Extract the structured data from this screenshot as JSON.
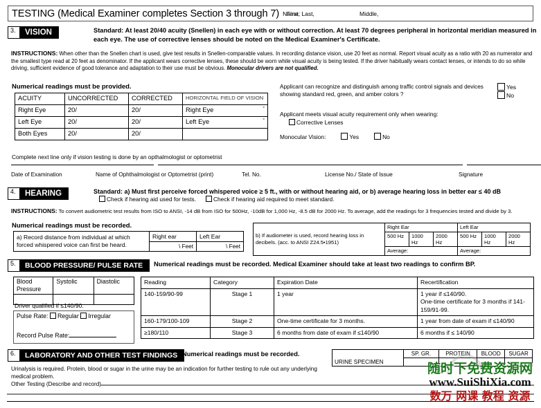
{
  "header": {
    "title": "TESTING (Medical Examiner completes Section 3 through 7)",
    "name_label": "Name:  Last,",
    "first_label": "First,",
    "middle_label": "Middle,"
  },
  "section3": {
    "number": "3.",
    "label": "VISION",
    "standard": "Standard: At least 20/40 acuity (Snellen) in each eye with or without correction. At least 70 degrees peripheral in horizontal meridian measured in each eye.  The use of corrective lenses should be noted on the Medical Examiner's Certificate.",
    "instructions_lead": "INSTRUCTIONS:",
    "instructions_body": " When other than the Snellen chart is used, give test results in Snellen-comparable values.  In recording distance vision, use 20 feet as normal.  Report visual acuity as a ratio with 20 as numerator and the smallest type read at 20 feet as denominator.  If the applicant wears corrective lenses, these should be worn while visual acuity is being tested.  If the driver habitually wears contact lenses, or intends to do so while driving, sufficient evidence of good tolerance and adaptation to their use must be obvious. ",
    "instructions_italic": "Monocular drivers are not qualified.",
    "numerical_note": "Numerical readings must be provided.",
    "acuity_table": {
      "headers": [
        "ACUITY",
        "UNCORRECTED",
        "CORRECTED",
        "HORIZONTAL FIELD OF VISION"
      ],
      "rows": [
        [
          "Right Eye",
          "20/",
          "20/",
          "Right Eye",
          "°"
        ],
        [
          "Left Eye",
          "20/",
          "20/",
          "Left Eye",
          "°"
        ],
        [
          "Both Eyes",
          "20/",
          "20/",
          "",
          ""
        ]
      ]
    },
    "complete_next_line": "Complete next line only if vision testing is done by an opthalmologist or optometrist",
    "question_traffic": "Applicant can recognize and distinguish among traffic control signals and devices showing standard red, green, and amber colors ?",
    "yes_label": "Yes",
    "no_label": "No",
    "question_acuity_wearing": "Applicant meets visual acuity requirement only when wearing:",
    "corrective_lenses_label": "Corrective Lenses",
    "monocular_label": "Monocular Vision:",
    "monocular_yes": "Yes",
    "monocular_no": "No",
    "signature_captions": [
      "Date of Examination",
      "Name of Ophthalmologist or Optometrist (print)",
      "Tel. No.",
      "License No./ State of Issue",
      "Signature"
    ]
  },
  "section4": {
    "number": "4.",
    "label": "HEARING",
    "standard": "Standard: a) Must first perceive forced whispered voice ≥ 5 ft., with or without hearing aid, or b) average hearing loss in better ear ≤ 40 dB",
    "check_used": "Check if hearing aid used for tests.",
    "check_required": "Check if hearing aid required to meet standard.",
    "instructions_lead": "INSTRUCTIONS:",
    "instructions_body": "  To convert audiometric test results from ISO to ANSI, -14 dB from ISO for 500Hz, -10dB for 1,000 Hz, -8.5 dB for 2000 Hz.  To average, add the readings for 3 frequencies tested and divide by 3.",
    "numerical_note": "Numerical readings must be recorded.",
    "item_a": "a) Record distance from individual at which forced whispered voice can first be heard.",
    "right_ear": "Right ear",
    "left_ear": "Left Ear",
    "feet": "\\ Feet",
    "item_b": "b) If audiometer is used, record hearing loss in decibels. (acc. to ANSI Z24.5•1951)",
    "audio_headers": {
      "right_ear": "Right Ear",
      "left_ear": "Left Ear",
      "freqs": [
        "500 Hz",
        "1000 Hz",
        "2000 Hz"
      ],
      "average": "Average:"
    }
  },
  "section5": {
    "number": "5.",
    "label": "BLOOD PRESSURE/ PULSE RATE",
    "note": "Numerical readings must be recorded.  Medical Examiner should take at least two readings to confirm BP.",
    "bp_table_headers": [
      "Blood Pressure",
      "Systolic",
      "Diastolic"
    ],
    "driver_qualified": "Driver qualified if ≤140/90.",
    "pulse_label": "Pulse Rate:",
    "pulse_regular": "Regular",
    "pulse_irregular": "Irregular",
    "record_pulse": "Record Pulse Rate:",
    "grid_headers": [
      "Reading",
      "Category",
      "Expiration Date",
      "Recertification"
    ],
    "grid_rows": [
      {
        "reading": "140-159/90-99",
        "category": "Stage 1",
        "expiration": "1 year",
        "recert": "1 year if ≤140/90.\nOne-time certificate for 3 months if 141-159/91-99."
      },
      {
        "reading": "160-179/100-109",
        "category": "Stage 2",
        "expiration": "One-time certificate for 3 months.",
        "recert": "1 year from date of exam if ≤140/90"
      },
      {
        "reading": "≥180/110",
        "category": "Stage 3",
        "expiration": "6 months from date of exam if ≤140/90",
        "recert": "6 months if ≤ 140/90"
      }
    ]
  },
  "section6": {
    "number": "6.",
    "label": "LABORATORY AND OTHER TEST FINDINGS",
    "note": "Numerical readings must be recorded.",
    "body": "Urinalysis is required.  Protein, blood or sugar in the urine may be an indication for further testing to rule out any underlying medical problem.",
    "other_testing": "Other Testing (Describe and record)",
    "urine_specimen": "URINE SPECIMEN",
    "urine_headers": [
      "SP. GR.",
      "PROTEIN",
      "BLOOD",
      "SUGAR"
    ]
  },
  "watermark": {
    "line1": "随时下免费资源网",
    "line2": "www.SuiShiXia.com",
    "line3": "数万 网课 教程 资源"
  }
}
